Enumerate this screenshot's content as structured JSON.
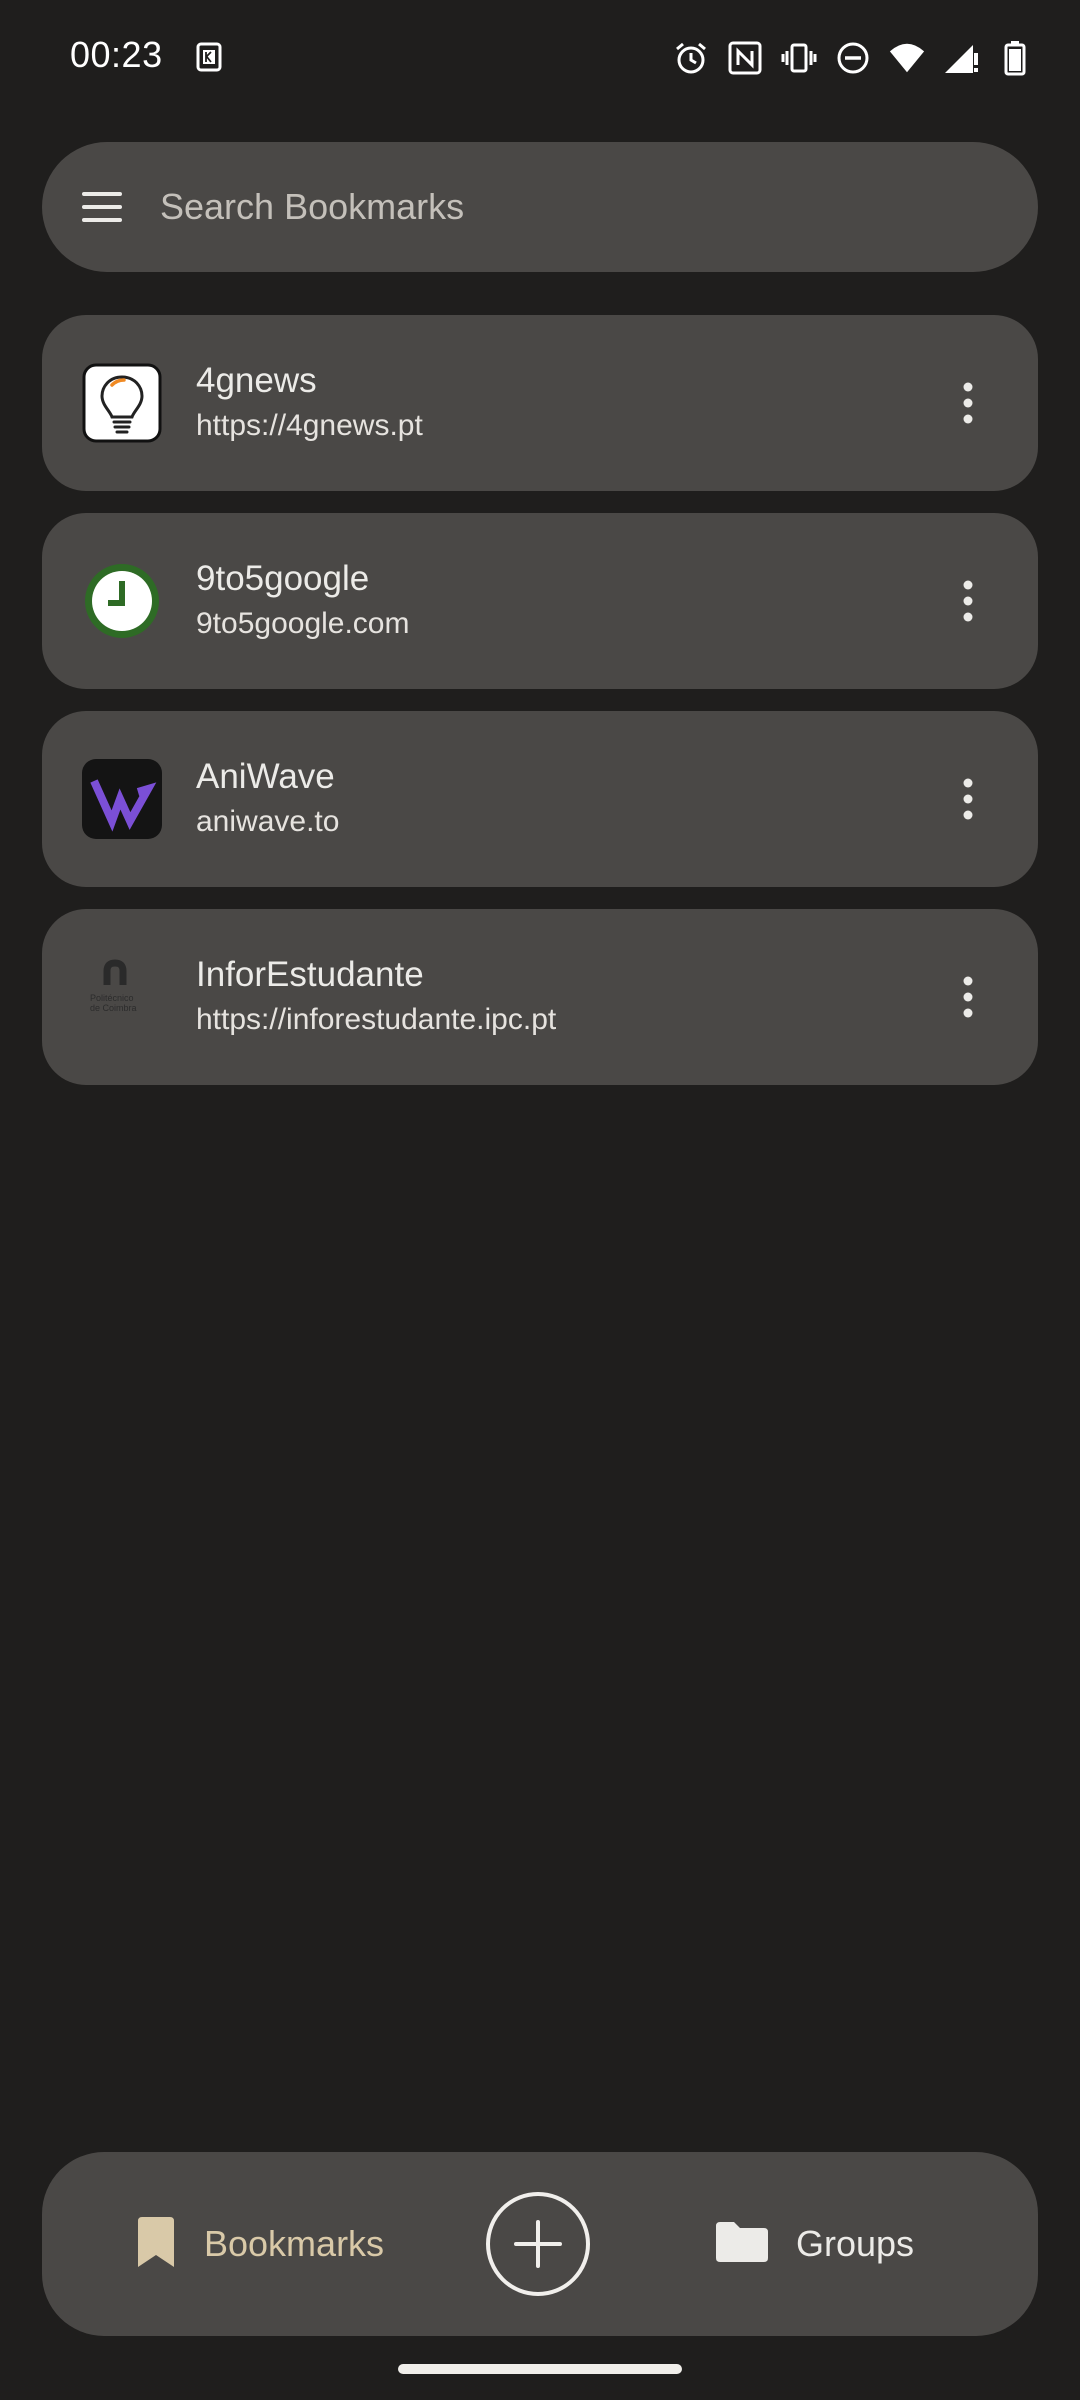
{
  "status_bar": {
    "time": "00:23",
    "icons": [
      "keyboard-notification-icon",
      "alarm-icon",
      "nfc-icon",
      "vibrate-icon",
      "do-not-disturb-icon",
      "wifi-icon",
      "signal-icon",
      "battery-icon"
    ]
  },
  "search": {
    "placeholder": "Search Bookmarks",
    "value": ""
  },
  "bookmarks": [
    {
      "title": "4gnews",
      "url": "https://4gnews.pt",
      "icon": "lightbulb-favicon"
    },
    {
      "title": "9to5google",
      "url": "9to5google.com",
      "icon": "clock-favicon"
    },
    {
      "title": "AniWave",
      "url": "aniwave.to",
      "icon": "aniwave-favicon"
    },
    {
      "title": "InforEstudante",
      "url": "https://inforestudante.ipc.pt",
      "icon": "politecnico-favicon",
      "logo_text": "Politécnico de Coimbra"
    }
  ],
  "bottom_nav": {
    "bookmarks_label": "Bookmarks",
    "groups_label": "Groups"
  },
  "colors": {
    "background": "#1f1e1d",
    "surface": "#4a4846",
    "accent": "#d9c9a8",
    "text": "#ecebe8"
  }
}
